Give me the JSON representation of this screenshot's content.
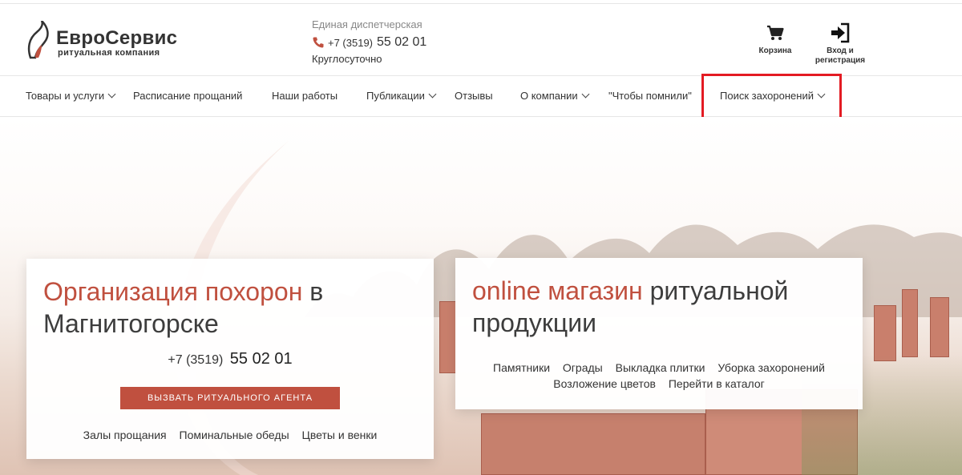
{
  "header": {
    "brand": {
      "name": "ЕвроСервис",
      "tagline": "ритуальная компания"
    },
    "contact": {
      "label": "Единая диспетчерская",
      "phone_prefix": "+7 (3519)",
      "phone_number": "55 02 01",
      "hours": "Круглосуточно"
    },
    "cart": {
      "label": "Корзина",
      "icon": "cart-icon"
    },
    "login": {
      "label_line1": "Вход и",
      "label_line2": "регистрация",
      "icon": "sign-in-icon"
    }
  },
  "nav": {
    "items": [
      {
        "label": "Товары и услуги",
        "dropdown": true
      },
      {
        "label": "Расписание прощаний",
        "dropdown": false
      },
      {
        "label": "Наши работы",
        "dropdown": false
      },
      {
        "label": "Публикации",
        "dropdown": true
      },
      {
        "label": "Отзывы",
        "dropdown": false
      },
      {
        "label": "О компании",
        "dropdown": true
      },
      {
        "label": "\"Чтобы помнили\"",
        "dropdown": false
      },
      {
        "label": "Поиск захоронений",
        "dropdown": true
      }
    ]
  },
  "hero": {
    "left_card": {
      "title_accent": "Организация похорон",
      "title_rest_1": " в",
      "title_rest_2": "Магнитогорске",
      "phone_prefix": "+7 (3519)",
      "phone_number": "55 02 01",
      "button_label": "ВЫЗВАТЬ РИТУАЛЬНОГО АГЕНТА",
      "links": [
        "Залы прощания",
        "Поминальные обеды",
        "Цветы и венки"
      ]
    },
    "right_card": {
      "title_accent": "online магазин",
      "title_rest_1": " ритуальной",
      "title_rest_2": "продукции",
      "links_row1": [
        "Памятники",
        "Ограды",
        "Выкладка плитки",
        "Уборка захоронений"
      ],
      "links_row2": [
        "Возложение цветов",
        "Перейти в каталог"
      ]
    }
  },
  "colors": {
    "accent": "#c0503f",
    "highlight": "#e31b23",
    "text": "#333333"
  }
}
